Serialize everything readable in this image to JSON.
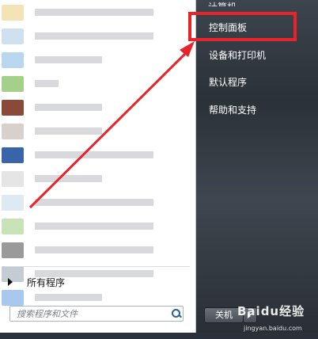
{
  "start_menu": {
    "right_items": [
      {
        "label": "计算机"
      },
      {
        "label": "控制面板"
      },
      {
        "label": "设备和打印机"
      },
      {
        "label": "默认程序"
      },
      {
        "label": "帮助和支持"
      }
    ],
    "all_programs_label": "所有程序",
    "search": {
      "placeholder": "搜索程序和文件"
    },
    "power_button_label": "关机"
  },
  "watermark": {
    "text": "Baidu经验",
    "url": "jingyan.baidu.com"
  },
  "colors": {
    "highlight": "#e8232a",
    "arrow": "#e8232a"
  }
}
